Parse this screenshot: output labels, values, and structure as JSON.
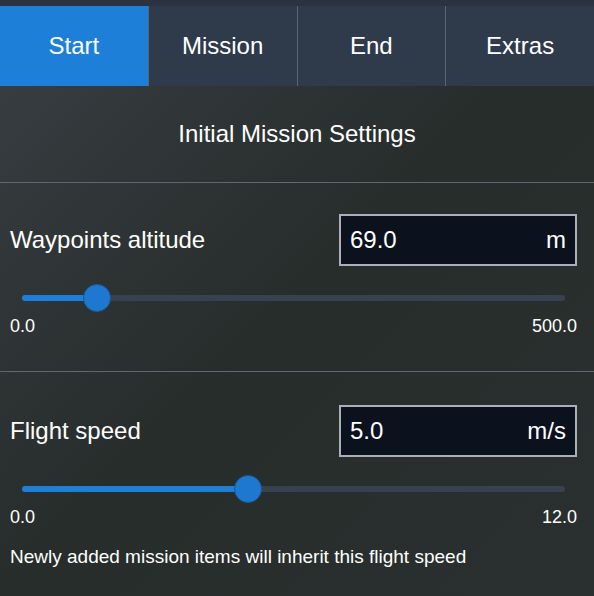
{
  "tabs": [
    {
      "label": "Start",
      "selected": true
    },
    {
      "label": "Mission",
      "selected": false
    },
    {
      "label": "End",
      "selected": false
    },
    {
      "label": "Extras",
      "selected": false
    }
  ],
  "header": "Initial Mission Settings",
  "fields": [
    {
      "label": "Waypoints altitude",
      "value": "69.0",
      "unit": "m",
      "min": "0.0",
      "max": "500.0",
      "level": 0.138,
      "note": ""
    },
    {
      "label": "Flight speed",
      "value": "5.0",
      "unit": "m/s",
      "min": "0.0",
      "max": "12.0",
      "level": 0.417,
      "note": "Newly added mission items will inherit this flight speed"
    }
  ]
}
